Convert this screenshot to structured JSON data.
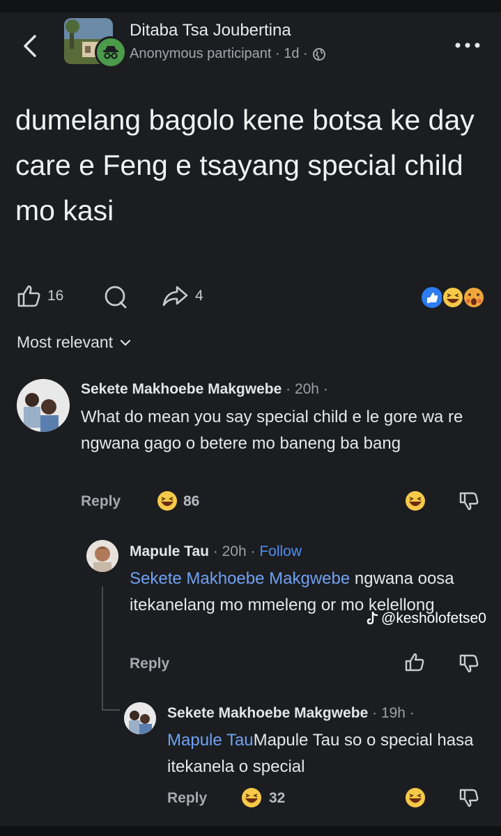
{
  "header": {
    "group_name": "Ditaba Tsa Joubertina",
    "meta": "Anonymous participant · 1d ·"
  },
  "post": {
    "text": "dumelang bagolo kene botsa ke day care e Feng e tsayang special child mo kasi",
    "like_count": "16",
    "share_count": "4"
  },
  "sort": {
    "label": "Most relevant"
  },
  "comments": [
    {
      "name": "Sekete Makhoebe Makgwebe",
      "time": "· 20h ·",
      "text": "What do mean you say special child e le gore wa re ngwana gago o betere mo baneng ba bang",
      "reply_label": "Reply",
      "reaction_count": "86"
    },
    {
      "name": "Mapule Tau",
      "time": "· 20h ·",
      "follow": "Follow",
      "mention": "Sekete Makhoebe Makgwebe",
      "text": " ngwana oosa itekanelang mo mmeleng or mo kelellong",
      "reply_label": "Reply"
    },
    {
      "name": "Sekete Makhoebe Makgwebe",
      "time": "· 19h ·",
      "mention": "Mapule Tau",
      "text": "Mapule Tau so o special hasa itekanela o special",
      "reply_label": "Reply",
      "reaction_count": "32"
    }
  ],
  "watermark": {
    "handle": "@kesholofetse0"
  },
  "colors": {
    "background": "#1c1d20",
    "link": "#4a8ff5",
    "mention": "#6ea2f3"
  }
}
